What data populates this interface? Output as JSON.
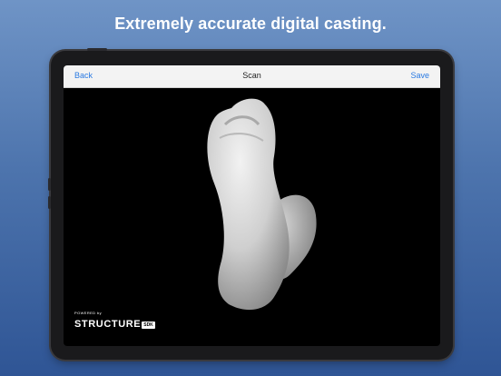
{
  "headline": "Extremely accurate digital casting.",
  "navbar": {
    "back_label": "Back",
    "title": "Scan",
    "save_label": "Save"
  },
  "sdk_logo": {
    "powered_by": "POWERED by",
    "brand": "STRUCTURE",
    "badge": "SDK"
  },
  "colors": {
    "accent": "#2a7ae2",
    "background_top": "#6f94c6",
    "background_bottom": "#2f5595"
  }
}
